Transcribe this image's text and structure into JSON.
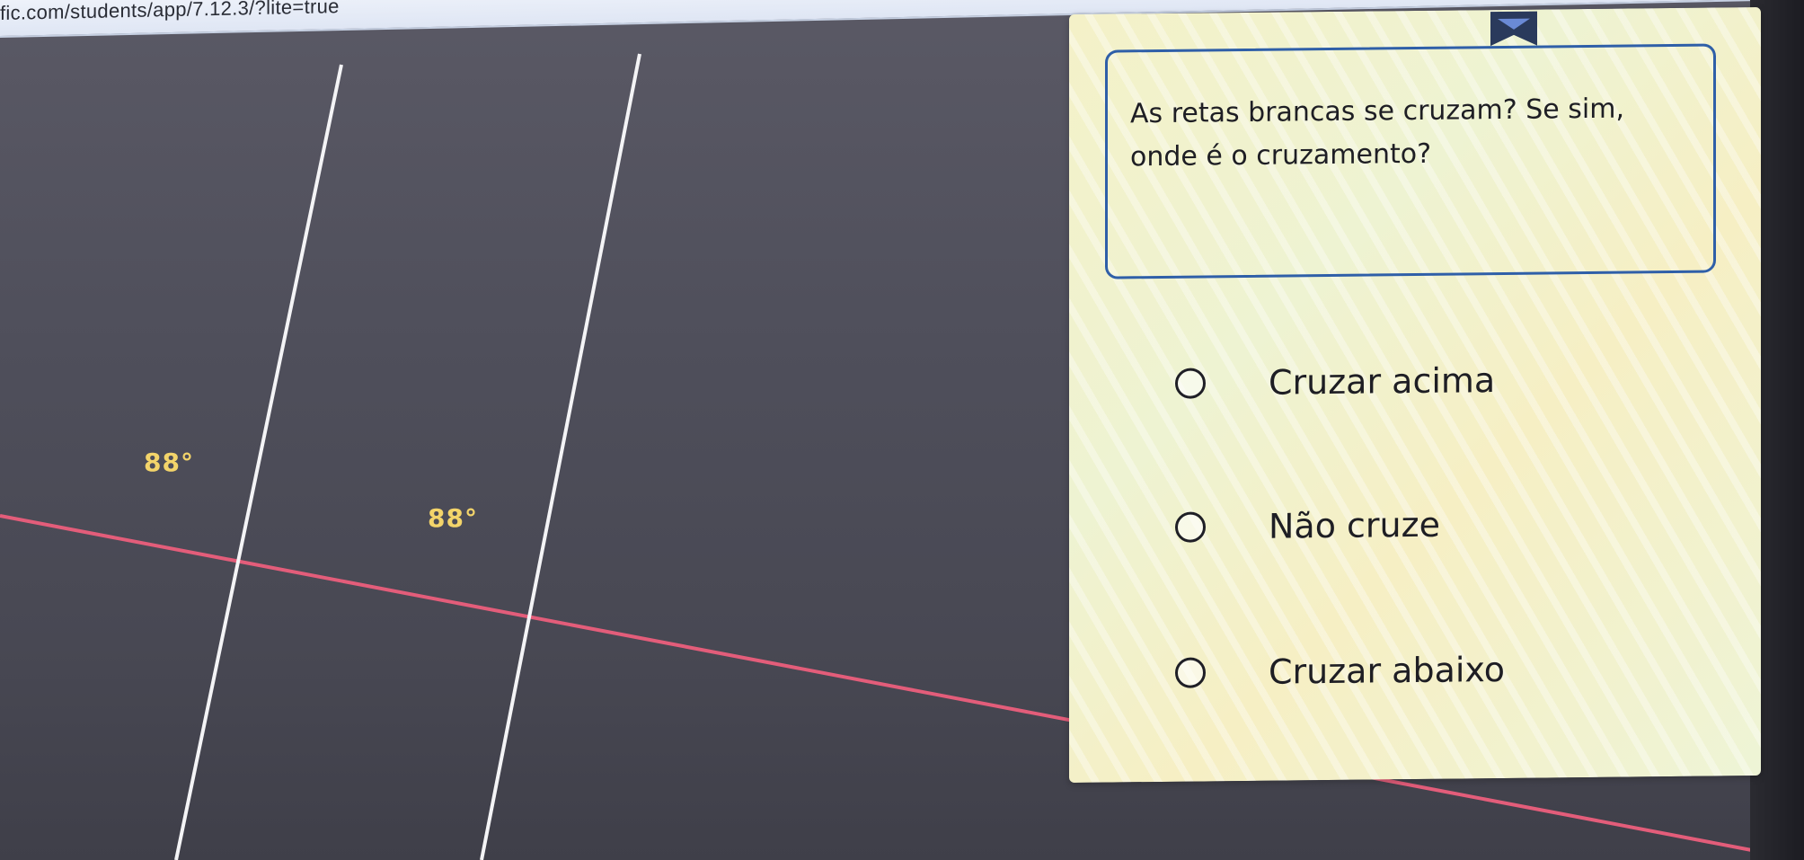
{
  "browser": {
    "url": "fic.com/students/app/7.12.3/?lite=true"
  },
  "figure": {
    "angle_labels": [
      "88°",
      "88°"
    ],
    "colors": {
      "white_lines": "#f4f4f6",
      "transversal": "#e35d7a",
      "angle_text": "#f3d46a"
    }
  },
  "question": {
    "text": "As retas brancas se cruzam? Se sim, onde é o cruzamento?",
    "options": [
      {
        "label": "Cruzar acima"
      },
      {
        "label": "Não cruze"
      },
      {
        "label": "Cruzar abaixo"
      }
    ]
  },
  "colors": {
    "panel_border": "#2f5fa8",
    "background": "#4d4d57"
  }
}
